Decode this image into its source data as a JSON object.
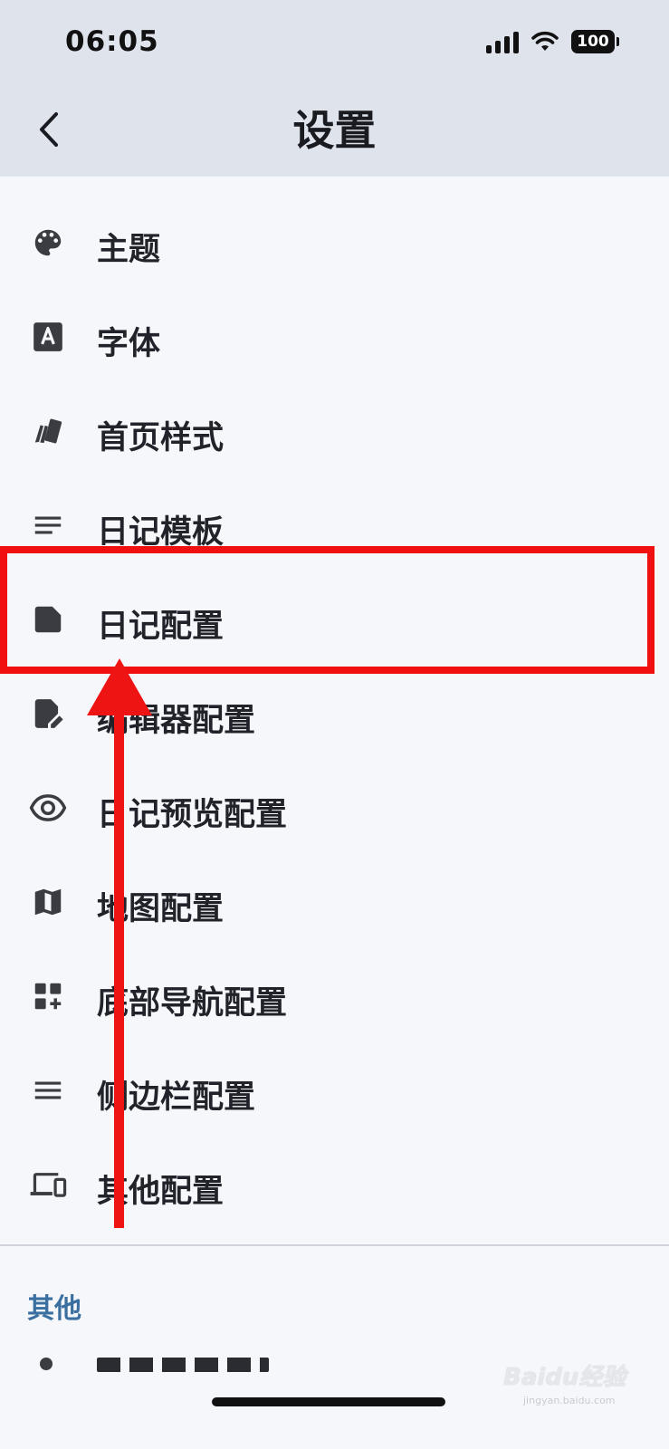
{
  "status_bar": {
    "time": "06:05",
    "battery": "100"
  },
  "header": {
    "title": "设置"
  },
  "menu": [
    {
      "label": "主题",
      "icon": "palette-icon"
    },
    {
      "label": "字体",
      "icon": "font-icon"
    },
    {
      "label": "首页样式",
      "icon": "cards-icon"
    },
    {
      "label": "日记模板",
      "icon": "text-lines-icon"
    },
    {
      "label": "日记配置",
      "icon": "note-icon"
    },
    {
      "label": "编辑器配置",
      "icon": "edit-document-icon"
    },
    {
      "label": "日记预览配置",
      "icon": "eye-icon"
    },
    {
      "label": "地图配置",
      "icon": "map-icon"
    },
    {
      "label": "底部导航配置",
      "icon": "grid-add-icon"
    },
    {
      "label": "侧边栏配置",
      "icon": "menu-icon"
    },
    {
      "label": "其他配置",
      "icon": "devices-icon"
    }
  ],
  "section": {
    "title": "其他"
  },
  "annotation": {
    "color": "#f01010"
  },
  "watermark": {
    "text": "Baidu经验",
    "sub": "jingyan.baidu.com"
  }
}
